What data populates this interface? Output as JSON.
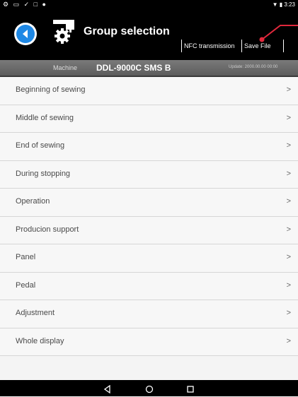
{
  "status_bar": {
    "left_icons": "⚙ ▭ ✓ □ ●",
    "right_text": "▼ ▮ 3:23"
  },
  "header": {
    "title": "Group selection",
    "nfc_button": "NFC transmission",
    "save_button": "Save File"
  },
  "info": {
    "machine_label": "Machine",
    "machine_model": "DDL-9000C SMS B",
    "update_label": "Update: 2000.00.00 00:00"
  },
  "menu": {
    "items": [
      {
        "label": "Beginning of sewing",
        "chevron": ">"
      },
      {
        "label": "Middle of sewing",
        "chevron": ">"
      },
      {
        "label": "End of sewing",
        "chevron": ">"
      },
      {
        "label": "During stopping",
        "chevron": ">"
      },
      {
        "label": "Operation",
        "chevron": ">"
      },
      {
        "label": "Producion support",
        "chevron": ">"
      },
      {
        "label": "Panel",
        "chevron": ">"
      },
      {
        "label": "Pedal",
        "chevron": ">"
      },
      {
        "label": "Adjustment",
        "chevron": ">"
      },
      {
        "label": "Whole display",
        "chevron": ">"
      }
    ]
  },
  "colors": {
    "back_button": "#1e88e5",
    "annotation": "#e0283c"
  },
  "icons": {
    "back": "back-arrow-icon",
    "gear": "gear-icon",
    "nav_back": "nav-back-icon",
    "nav_home": "nav-home-icon",
    "nav_recent": "nav-recent-icon"
  }
}
